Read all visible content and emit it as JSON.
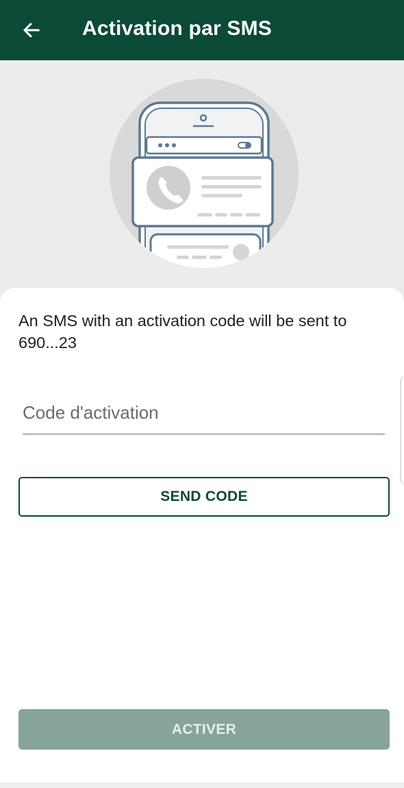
{
  "header": {
    "title": "Activation par SMS",
    "back_icon": "arrow-left-icon"
  },
  "illustration": {
    "icon": "phone-sms-illustration",
    "phone_icon": "phone-call-icon"
  },
  "content": {
    "info_text": "An SMS with an activation code will be sent to 690...23",
    "code_field": {
      "value": "",
      "placeholder": "Code d'activation"
    },
    "send_code_label": "SEND CODE",
    "activate_label": "ACTIVER"
  },
  "colors": {
    "primary": "#0a4a36",
    "background": "#ececec",
    "disabled_button": "#86a49a"
  }
}
